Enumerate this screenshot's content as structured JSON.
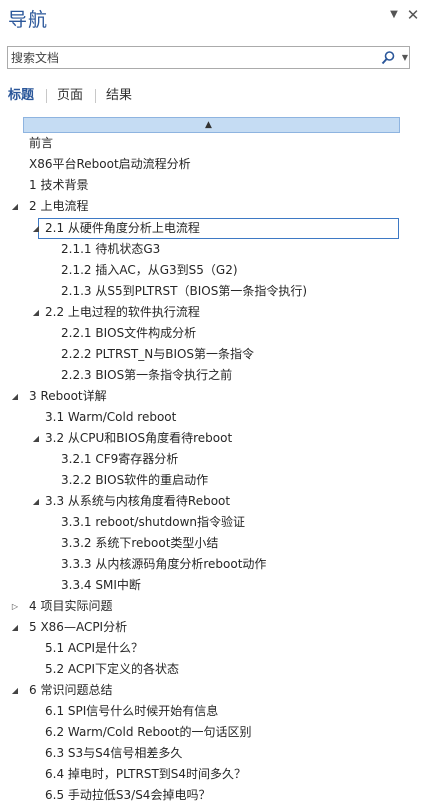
{
  "header": {
    "title": "导航"
  },
  "search": {
    "placeholder": "搜索文档"
  },
  "tabs": [
    {
      "label": "标题"
    },
    {
      "label": "页面"
    },
    {
      "label": "结果"
    }
  ],
  "outline": [
    {
      "label": "前言",
      "toggle": ""
    },
    {
      "label": "X86平台Reboot启动流程分析",
      "toggle": ""
    },
    {
      "label": "1 技术背景",
      "toggle": ""
    },
    {
      "label": "2 上电流程",
      "toggle": "◢"
    },
    {
      "label": "2.1 从硬件角度分析上电流程",
      "toggle": "◢"
    },
    {
      "label": "2.1.1 待机状态G3",
      "toggle": ""
    },
    {
      "label": "2.1.2 插入AC，从G3到S5（G2)",
      "toggle": ""
    },
    {
      "label": "2.1.3 从S5到PLTRST（BIOS第一条指令执行)",
      "toggle": ""
    },
    {
      "label": "2.2 上电过程的软件执行流程",
      "toggle": "◢"
    },
    {
      "label": "2.2.1 BIOS文件构成分析",
      "toggle": ""
    },
    {
      "label": "2.2.2 PLTRST_N与BIOS第一条指令",
      "toggle": ""
    },
    {
      "label": "2.2.3 BIOS第一条指令执行之前",
      "toggle": ""
    },
    {
      "label": "3 Reboot详解",
      "toggle": "◢"
    },
    {
      "label": "3.1 Warm/Cold reboot",
      "toggle": ""
    },
    {
      "label": "3.2 从CPU和BIOS角度看待reboot",
      "toggle": "◢"
    },
    {
      "label": "3.2.1 CF9寄存器分析",
      "toggle": ""
    },
    {
      "label": "3.2.2 BIOS软件的重启动作",
      "toggle": ""
    },
    {
      "label": "3.3 从系统与内核角度看待Reboot",
      "toggle": "◢"
    },
    {
      "label": "3.3.1 reboot/shutdown指令验证",
      "toggle": ""
    },
    {
      "label": "3.3.2 系统下reboot类型小结",
      "toggle": ""
    },
    {
      "label": "3.3.3 从内核源码角度分析reboot动作",
      "toggle": ""
    },
    {
      "label": "3.3.4 SMI中断",
      "toggle": ""
    },
    {
      "label": "4 项目实际问题",
      "toggle": "▷"
    },
    {
      "label": "5 X86—ACPI分析",
      "toggle": "◢"
    },
    {
      "label": "5.1 ACPI是什么？",
      "toggle": ""
    },
    {
      "label": "5.2 ACPI下定义的各状态",
      "toggle": ""
    },
    {
      "label": "6 常识问题总结",
      "toggle": "◢"
    },
    {
      "label": "6.1 SPI信号什么时候开始有信息",
      "toggle": ""
    },
    {
      "label": "6.2 Warm/Cold Reboot的一句话区别",
      "toggle": ""
    },
    {
      "label": "6.3 S3与S4信号相差多久",
      "toggle": ""
    },
    {
      "label": "6.4 掉电时，PLTRST到S4时间多久？",
      "toggle": ""
    },
    {
      "label": "6.5 手动拉低S3/S4会掉电吗？",
      "toggle": ""
    }
  ]
}
